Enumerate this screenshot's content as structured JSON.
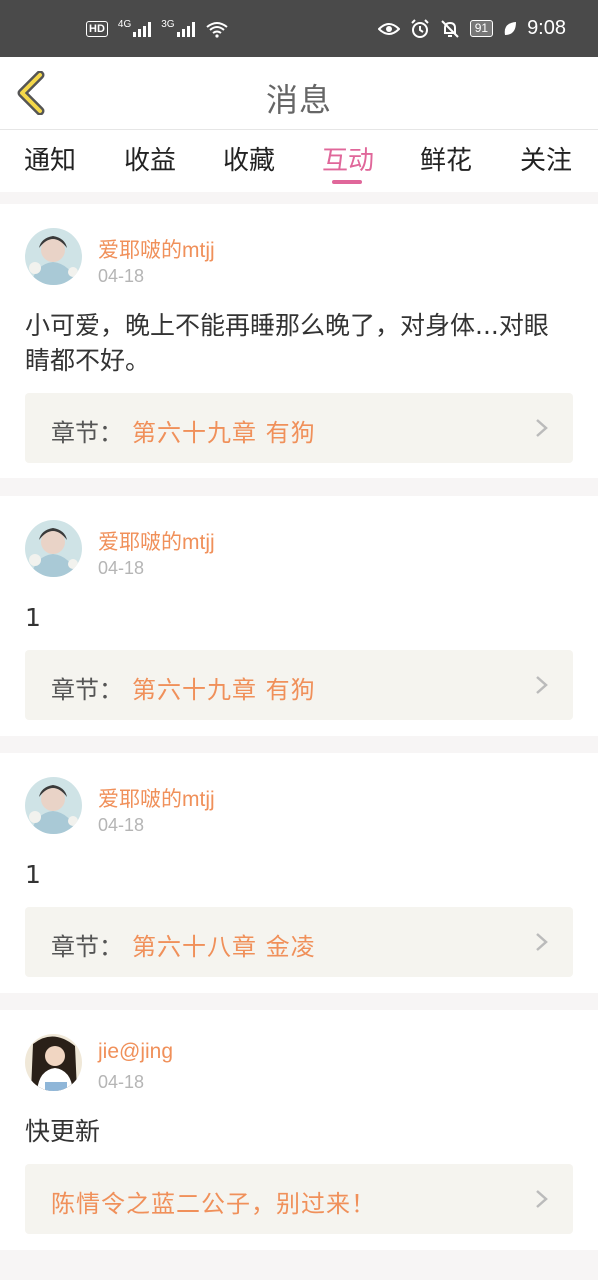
{
  "status_bar": {
    "network_badge": "HD",
    "net1": "4G",
    "net2": "3G",
    "battery": "91",
    "time": "9:08"
  },
  "header": {
    "title": "消息",
    "back_icon": "chevron-left-icon"
  },
  "tabs": [
    {
      "label": "通知",
      "active": false
    },
    {
      "label": "收益",
      "active": false
    },
    {
      "label": "收藏",
      "active": false
    },
    {
      "label": "互动",
      "active": true
    },
    {
      "label": "鲜花",
      "active": false
    },
    {
      "label": "关注",
      "active": false
    }
  ],
  "messages": [
    {
      "user": "爱耶啵的mtjj",
      "date": "04-18",
      "content": "小可爱，晚上不能再睡那么晚了，对身体...对眼睛都不好。",
      "chapter_label": "章节：",
      "chapter_title": "第六十九章  有狗"
    },
    {
      "user": "爱耶啵的mtjj",
      "date": "04-18",
      "content": "1",
      "chapter_label": "章节：",
      "chapter_title": "第六十九章  有狗"
    },
    {
      "user": "爱耶啵的mtjj",
      "date": "04-18",
      "content": "1",
      "chapter_label": "章节：",
      "chapter_title": "第六十八章  金凌"
    },
    {
      "user": "jie@jing",
      "date": "04-18",
      "content": "快更新",
      "book_title": "陈情令之蓝二公子，别过来！"
    }
  ],
  "colors": {
    "accent": "#e0679a",
    "orange": "#f0905a"
  }
}
